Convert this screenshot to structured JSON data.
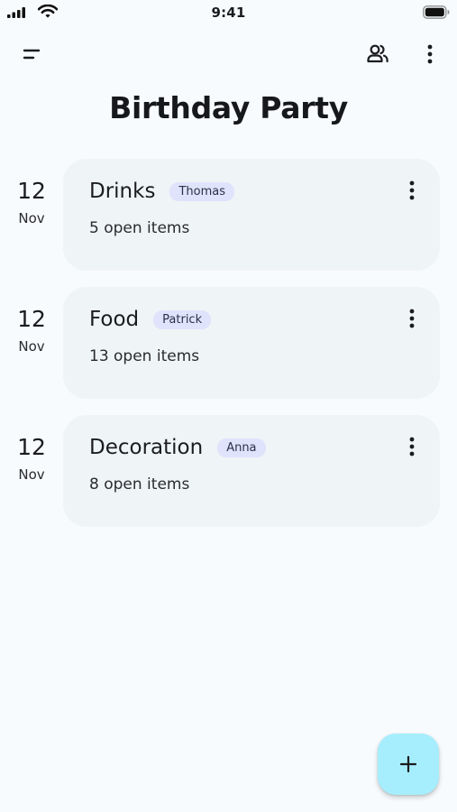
{
  "status_bar": {
    "time": "9:41",
    "icons": [
      "signal-icon",
      "wifi-icon",
      "battery-icon"
    ]
  },
  "top_bar": {
    "icons": [
      "menu-icon",
      "people-icon",
      "more-vertical-icon"
    ]
  },
  "page": {
    "title": "Birthday Party"
  },
  "lists": [
    {
      "day": "12",
      "month": "Nov",
      "title": "Drinks",
      "assignee": "Thomas",
      "subtitle": "5 open items"
    },
    {
      "day": "12",
      "month": "Nov",
      "title": "Food",
      "assignee": "Patrick",
      "subtitle": "13 open items"
    },
    {
      "day": "12",
      "month": "Nov",
      "title": "Decoration",
      "assignee": "Anna",
      "subtitle": "8 open items"
    }
  ],
  "fab": {
    "icon": "plus-icon"
  },
  "colors": {
    "background": "#f8fbfd",
    "card": "#eff4f7",
    "badge": "#dfe3fb",
    "fab": "#a6eefd",
    "text": "#1b1c1f"
  }
}
